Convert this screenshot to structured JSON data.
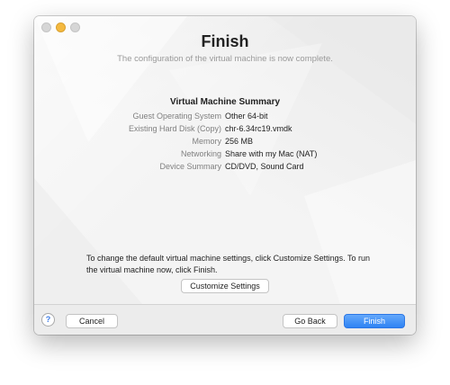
{
  "window": {
    "title": "Finish",
    "subtitle": "The configuration of the virtual machine is now complete."
  },
  "summary": {
    "heading": "Virtual Machine Summary",
    "rows": [
      {
        "label": "Guest Operating System",
        "value": "Other 64-bit"
      },
      {
        "label": "Existing Hard Disk (Copy)",
        "value": "chr-6.34rc19.vmdk"
      },
      {
        "label": "Memory",
        "value": "256 MB"
      },
      {
        "label": "Networking",
        "value": "Share with my Mac (NAT)"
      },
      {
        "label": "Device Summary",
        "value": "CD/DVD, Sound Card"
      }
    ]
  },
  "info": {
    "text": "To change the default virtual machine settings, click Customize Settings. To run the virtual machine now, click Finish."
  },
  "buttons": {
    "customize": "Customize Settings",
    "help": "?",
    "cancel": "Cancel",
    "go_back": "Go Back",
    "finish": "Finish"
  },
  "colors": {
    "accent": "#2f83f3",
    "minimize_light": "#f4b93f"
  }
}
